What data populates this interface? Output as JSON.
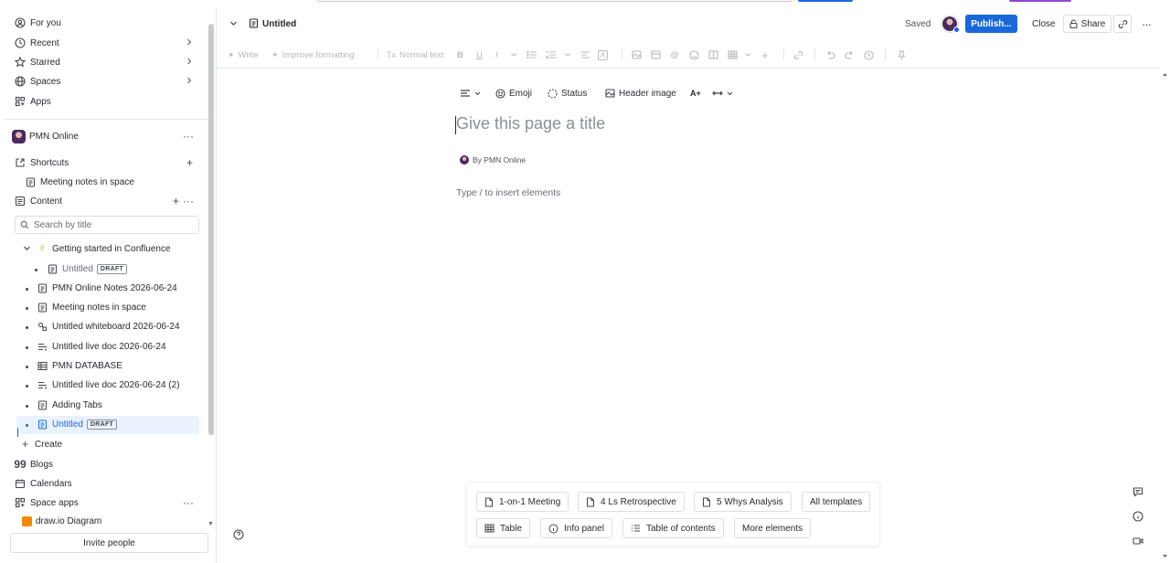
{
  "sidebar": {
    "top_nav": [
      {
        "label": "For you",
        "icon": "for-you-icon"
      },
      {
        "label": "Recent",
        "icon": "clock-icon"
      },
      {
        "label": "Starred",
        "icon": "star-icon"
      },
      {
        "label": "Spaces",
        "icon": "globe-icon"
      },
      {
        "label": "Apps",
        "icon": "apps-icon"
      }
    ],
    "space_name": "PMN Online",
    "shortcuts_label": "Shortcuts",
    "shortcut_item": "Meeting notes in space",
    "content_label": "Content",
    "search_placeholder": "Search by title",
    "tree": [
      {
        "label": "Getting started in Confluence",
        "icon": "emoji-icon"
      },
      {
        "label": "Untitled",
        "icon": "page-icon",
        "badge": "DRAFT"
      },
      {
        "label": "PMN Online Notes 2026-06-24",
        "icon": "page-icon"
      },
      {
        "label": "Meeting notes in space",
        "icon": "page-icon"
      },
      {
        "label": "Untitled whiteboard 2026-06-24",
        "icon": "whiteboard-icon"
      },
      {
        "label": "Untitled live doc 2026-06-24",
        "icon": "live-doc-icon"
      },
      {
        "label": "PMN DATABASE",
        "icon": "database-icon"
      },
      {
        "label": "Untitled live doc 2026-06-24 (2)",
        "icon": "live-doc-icon"
      },
      {
        "label": "Adding Tabs",
        "icon": "page-icon"
      },
      {
        "label": "Untitled",
        "icon": "page-icon",
        "badge": "DRAFT"
      }
    ],
    "create_label": "Create",
    "blogs_label": "Blogs",
    "calendars_label": "Calendars",
    "space_apps_label": "Space apps",
    "drawio_label": "draw.io Diagram",
    "invite_label": "Invite people"
  },
  "header": {
    "title": "Untitled",
    "saved": "Saved",
    "publish": "Publish...",
    "close": "Close",
    "share": "Share"
  },
  "toolbar": {
    "write": "Write",
    "improve": "Improve formatting",
    "text_style": "Normal text"
  },
  "editor": {
    "emoji": "Emoji",
    "status": "Status",
    "header_image": "Header image",
    "title_placeholder": "Give this page a title",
    "byline": "By PMN Online",
    "body_placeholder": "Type / to insert elements"
  },
  "templates": {
    "buttons": [
      "1-on-1 Meeting",
      "4 Ls Retrospective",
      "5 Whys Analysis",
      "All templates"
    ],
    "elements": [
      "Table",
      "Info panel",
      "Table of contents",
      "More elements"
    ]
  },
  "colors": {
    "accent": "#1868db",
    "selected_bg": "#e9f2fe",
    "text": "#292a2e",
    "muted": "#6a6c72"
  }
}
